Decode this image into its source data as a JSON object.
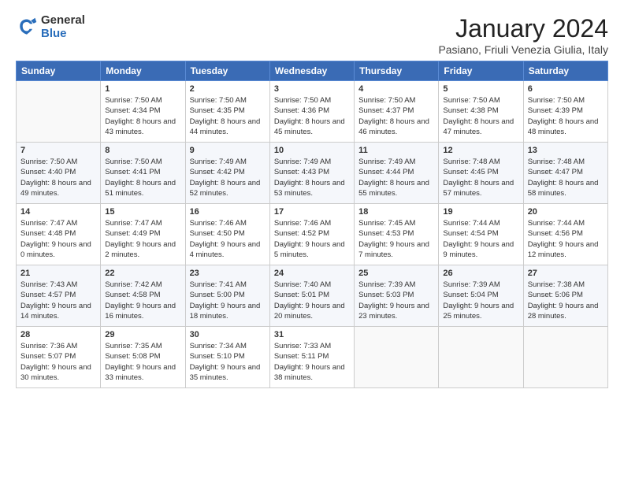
{
  "logo": {
    "general": "General",
    "blue": "Blue"
  },
  "title": "January 2024",
  "location": "Pasiano, Friuli Venezia Giulia, Italy",
  "headers": [
    "Sunday",
    "Monday",
    "Tuesday",
    "Wednesday",
    "Thursday",
    "Friday",
    "Saturday"
  ],
  "weeks": [
    [
      {
        "day": "",
        "sunrise": "",
        "sunset": "",
        "daylight": ""
      },
      {
        "day": "1",
        "sunrise": "Sunrise: 7:50 AM",
        "sunset": "Sunset: 4:34 PM",
        "daylight": "Daylight: 8 hours and 43 minutes."
      },
      {
        "day": "2",
        "sunrise": "Sunrise: 7:50 AM",
        "sunset": "Sunset: 4:35 PM",
        "daylight": "Daylight: 8 hours and 44 minutes."
      },
      {
        "day": "3",
        "sunrise": "Sunrise: 7:50 AM",
        "sunset": "Sunset: 4:36 PM",
        "daylight": "Daylight: 8 hours and 45 minutes."
      },
      {
        "day": "4",
        "sunrise": "Sunrise: 7:50 AM",
        "sunset": "Sunset: 4:37 PM",
        "daylight": "Daylight: 8 hours and 46 minutes."
      },
      {
        "day": "5",
        "sunrise": "Sunrise: 7:50 AM",
        "sunset": "Sunset: 4:38 PM",
        "daylight": "Daylight: 8 hours and 47 minutes."
      },
      {
        "day": "6",
        "sunrise": "Sunrise: 7:50 AM",
        "sunset": "Sunset: 4:39 PM",
        "daylight": "Daylight: 8 hours and 48 minutes."
      }
    ],
    [
      {
        "day": "7",
        "sunrise": "Sunrise: 7:50 AM",
        "sunset": "Sunset: 4:40 PM",
        "daylight": "Daylight: 8 hours and 49 minutes."
      },
      {
        "day": "8",
        "sunrise": "Sunrise: 7:50 AM",
        "sunset": "Sunset: 4:41 PM",
        "daylight": "Daylight: 8 hours and 51 minutes."
      },
      {
        "day": "9",
        "sunrise": "Sunrise: 7:49 AM",
        "sunset": "Sunset: 4:42 PM",
        "daylight": "Daylight: 8 hours and 52 minutes."
      },
      {
        "day": "10",
        "sunrise": "Sunrise: 7:49 AM",
        "sunset": "Sunset: 4:43 PM",
        "daylight": "Daylight: 8 hours and 53 minutes."
      },
      {
        "day": "11",
        "sunrise": "Sunrise: 7:49 AM",
        "sunset": "Sunset: 4:44 PM",
        "daylight": "Daylight: 8 hours and 55 minutes."
      },
      {
        "day": "12",
        "sunrise": "Sunrise: 7:48 AM",
        "sunset": "Sunset: 4:45 PM",
        "daylight": "Daylight: 8 hours and 57 minutes."
      },
      {
        "day": "13",
        "sunrise": "Sunrise: 7:48 AM",
        "sunset": "Sunset: 4:47 PM",
        "daylight": "Daylight: 8 hours and 58 minutes."
      }
    ],
    [
      {
        "day": "14",
        "sunrise": "Sunrise: 7:47 AM",
        "sunset": "Sunset: 4:48 PM",
        "daylight": "Daylight: 9 hours and 0 minutes."
      },
      {
        "day": "15",
        "sunrise": "Sunrise: 7:47 AM",
        "sunset": "Sunset: 4:49 PM",
        "daylight": "Daylight: 9 hours and 2 minutes."
      },
      {
        "day": "16",
        "sunrise": "Sunrise: 7:46 AM",
        "sunset": "Sunset: 4:50 PM",
        "daylight": "Daylight: 9 hours and 4 minutes."
      },
      {
        "day": "17",
        "sunrise": "Sunrise: 7:46 AM",
        "sunset": "Sunset: 4:52 PM",
        "daylight": "Daylight: 9 hours and 5 minutes."
      },
      {
        "day": "18",
        "sunrise": "Sunrise: 7:45 AM",
        "sunset": "Sunset: 4:53 PM",
        "daylight": "Daylight: 9 hours and 7 minutes."
      },
      {
        "day": "19",
        "sunrise": "Sunrise: 7:44 AM",
        "sunset": "Sunset: 4:54 PM",
        "daylight": "Daylight: 9 hours and 9 minutes."
      },
      {
        "day": "20",
        "sunrise": "Sunrise: 7:44 AM",
        "sunset": "Sunset: 4:56 PM",
        "daylight": "Daylight: 9 hours and 12 minutes."
      }
    ],
    [
      {
        "day": "21",
        "sunrise": "Sunrise: 7:43 AM",
        "sunset": "Sunset: 4:57 PM",
        "daylight": "Daylight: 9 hours and 14 minutes."
      },
      {
        "day": "22",
        "sunrise": "Sunrise: 7:42 AM",
        "sunset": "Sunset: 4:58 PM",
        "daylight": "Daylight: 9 hours and 16 minutes."
      },
      {
        "day": "23",
        "sunrise": "Sunrise: 7:41 AM",
        "sunset": "Sunset: 5:00 PM",
        "daylight": "Daylight: 9 hours and 18 minutes."
      },
      {
        "day": "24",
        "sunrise": "Sunrise: 7:40 AM",
        "sunset": "Sunset: 5:01 PM",
        "daylight": "Daylight: 9 hours and 20 minutes."
      },
      {
        "day": "25",
        "sunrise": "Sunrise: 7:39 AM",
        "sunset": "Sunset: 5:03 PM",
        "daylight": "Daylight: 9 hours and 23 minutes."
      },
      {
        "day": "26",
        "sunrise": "Sunrise: 7:39 AM",
        "sunset": "Sunset: 5:04 PM",
        "daylight": "Daylight: 9 hours and 25 minutes."
      },
      {
        "day": "27",
        "sunrise": "Sunrise: 7:38 AM",
        "sunset": "Sunset: 5:06 PM",
        "daylight": "Daylight: 9 hours and 28 minutes."
      }
    ],
    [
      {
        "day": "28",
        "sunrise": "Sunrise: 7:36 AM",
        "sunset": "Sunset: 5:07 PM",
        "daylight": "Daylight: 9 hours and 30 minutes."
      },
      {
        "day": "29",
        "sunrise": "Sunrise: 7:35 AM",
        "sunset": "Sunset: 5:08 PM",
        "daylight": "Daylight: 9 hours and 33 minutes."
      },
      {
        "day": "30",
        "sunrise": "Sunrise: 7:34 AM",
        "sunset": "Sunset: 5:10 PM",
        "daylight": "Daylight: 9 hours and 35 minutes."
      },
      {
        "day": "31",
        "sunrise": "Sunrise: 7:33 AM",
        "sunset": "Sunset: 5:11 PM",
        "daylight": "Daylight: 9 hours and 38 minutes."
      },
      {
        "day": "",
        "sunrise": "",
        "sunset": "",
        "daylight": ""
      },
      {
        "day": "",
        "sunrise": "",
        "sunset": "",
        "daylight": ""
      },
      {
        "day": "",
        "sunrise": "",
        "sunset": "",
        "daylight": ""
      }
    ]
  ]
}
